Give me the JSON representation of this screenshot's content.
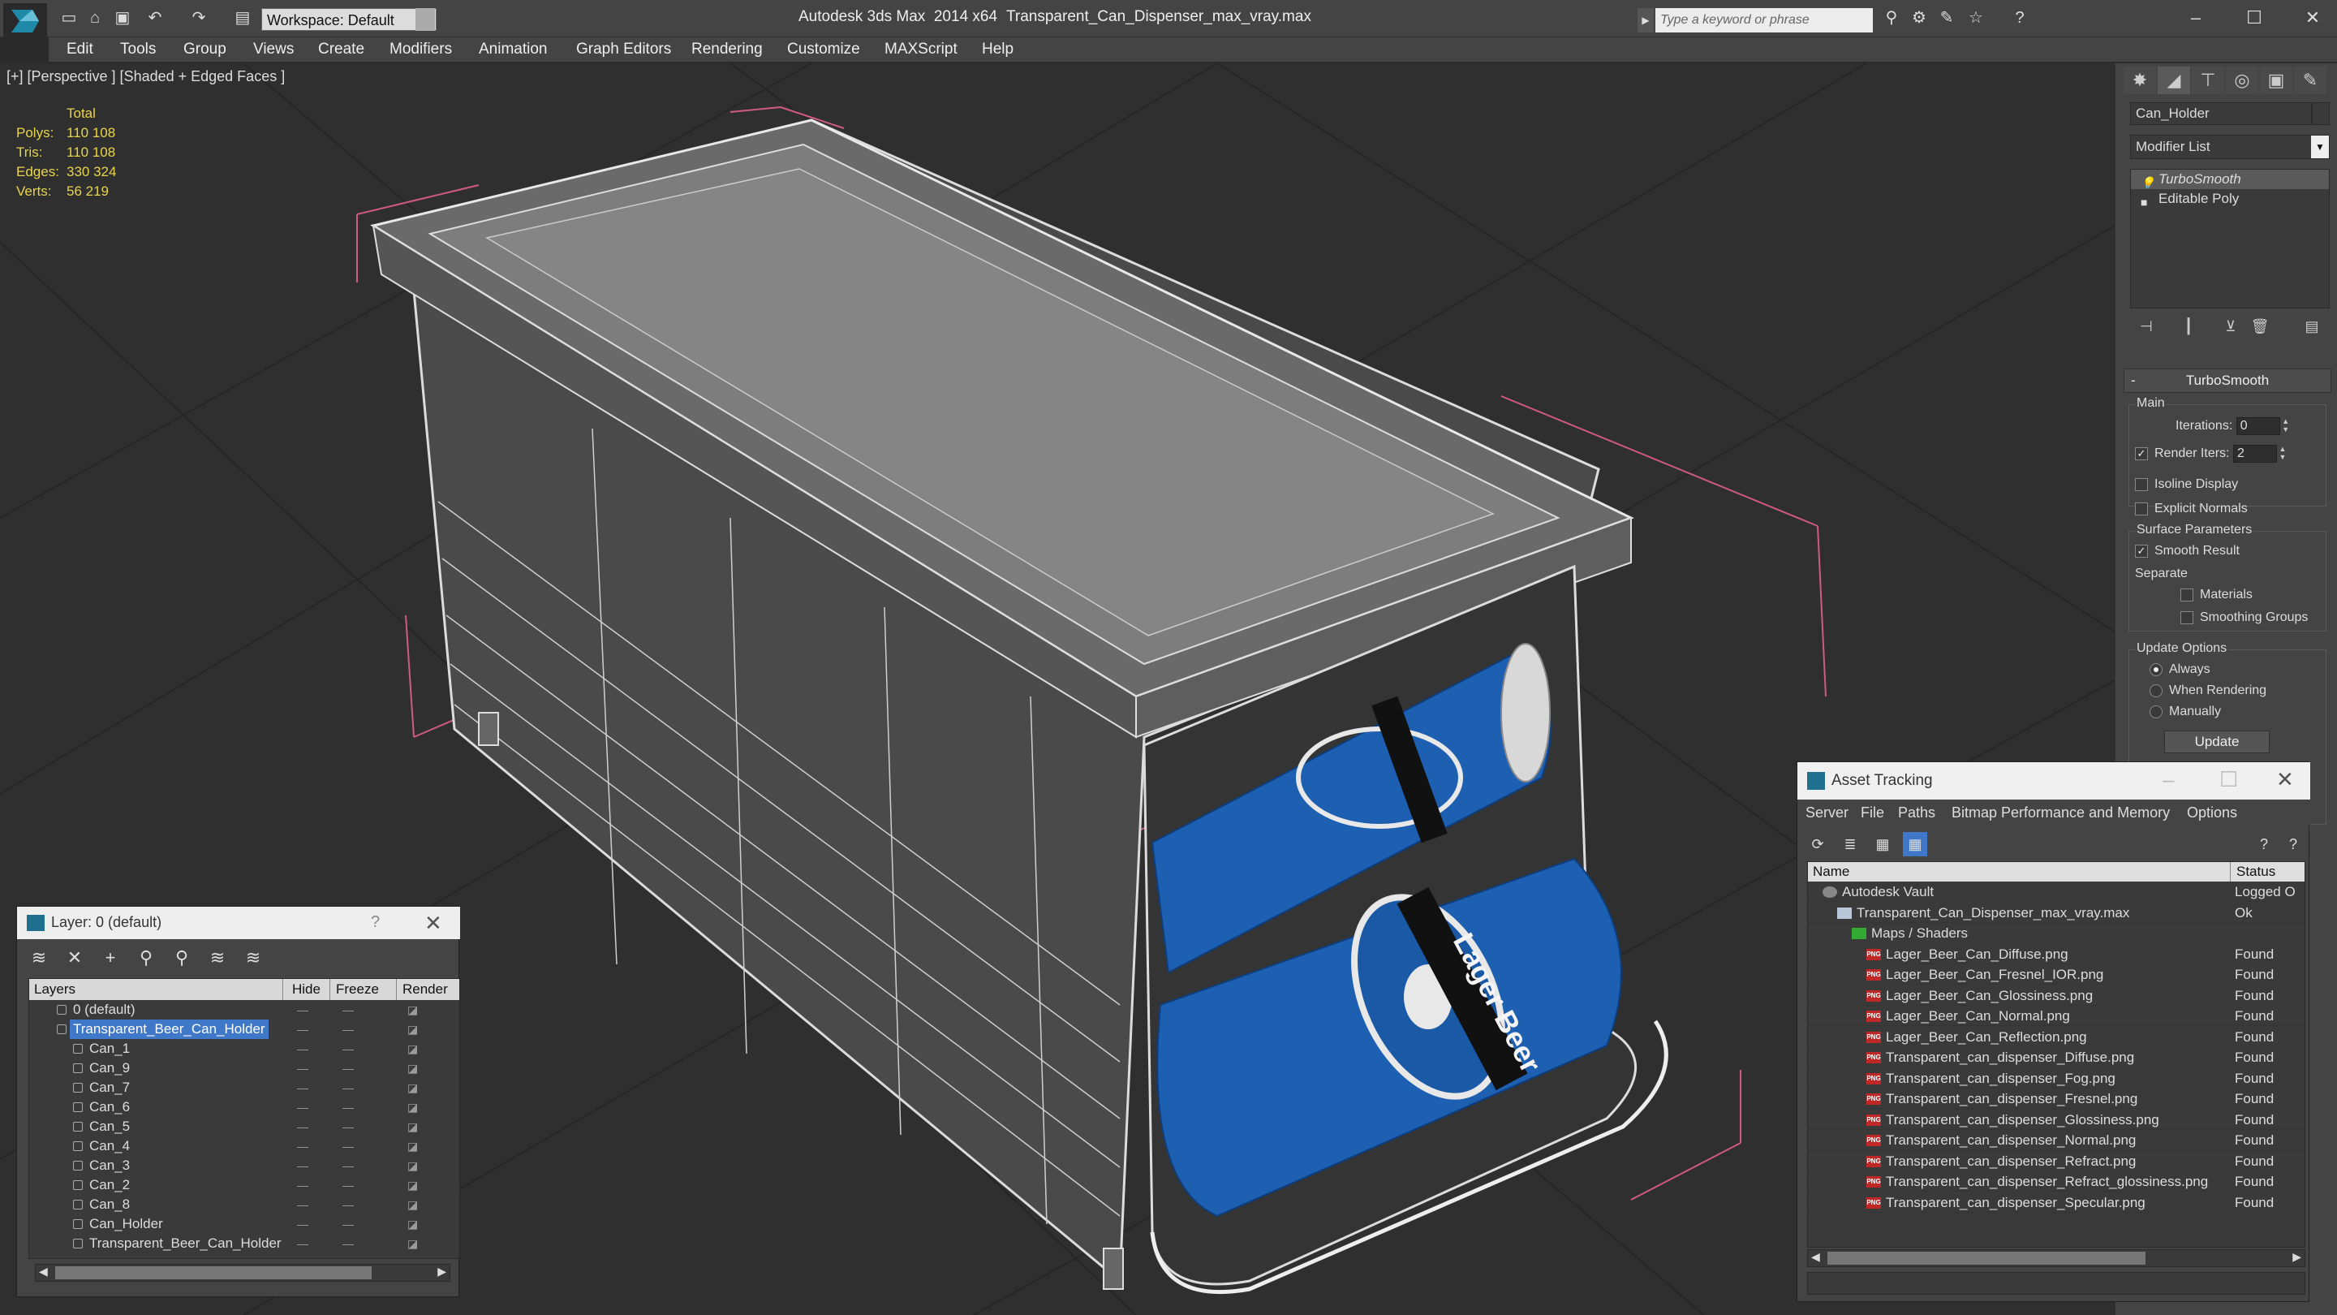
{
  "titlebar": {
    "workspace_label": "Workspace: Default",
    "app_title": "Autodesk 3ds Max  2014 x64",
    "file_title": "Transparent_Can_Dispenser_max_vray.max",
    "search_placeholder": "Type a keyword or phrase"
  },
  "menu": [
    "Edit",
    "Tools",
    "Group",
    "Views",
    "Create",
    "Modifiers",
    "Animation",
    "Graph Editors",
    "Rendering",
    "Customize",
    "MAXScript",
    "Help"
  ],
  "viewport": {
    "label": "[+] [Perspective ] [Shaded + Edged Faces ]",
    "stats": {
      "total_label": "Total",
      "polys_label": "Polys:",
      "polys": "110 108",
      "tris_label": "Tris:",
      "tris": "110 108",
      "edges_label": "Edges:",
      "edges": "330 324",
      "verts_label": "Verts:",
      "verts": "56 219"
    },
    "can_text": "Lager Beer"
  },
  "command_panel": {
    "object_name": "Can_Holder",
    "modifier_list": "Modifier List",
    "stack": [
      "TurboSmooth",
      "Editable Poly"
    ],
    "rollout_title": "TurboSmooth",
    "main_group": "Main",
    "iterations_label": "Iterations:",
    "iterations_value": "0",
    "render_iters_label": "Render Iters:",
    "render_iters_value": "2",
    "render_iters_checked": true,
    "isoline_label": "Isoline Display",
    "explicit_normals_label": "Explicit Normals",
    "surface_group": "Surface Parameters",
    "smooth_result_label": "Smooth Result",
    "smooth_result_checked": true,
    "separate_label": "Separate",
    "materials_label": "Materials",
    "smoothing_groups_label": "Smoothing Groups",
    "update_group": "Update Options",
    "always_label": "Always",
    "when_rendering_label": "When Rendering",
    "manually_label": "Manually",
    "selected_update": "Always",
    "update_button": "Update"
  },
  "layer_window": {
    "title": "Layer: 0 (default)",
    "help": "?",
    "columns": [
      "Layers",
      "Hide",
      "Freeze",
      "Render"
    ],
    "rows": [
      {
        "name": "0 (default)",
        "level": 1
      },
      {
        "name": "Transparent_Beer_Can_Holder",
        "level": 1,
        "selected": true
      },
      {
        "name": "Can_1",
        "level": 2
      },
      {
        "name": "Can_9",
        "level": 2
      },
      {
        "name": "Can_7",
        "level": 2
      },
      {
        "name": "Can_6",
        "level": 2
      },
      {
        "name": "Can_5",
        "level": 2
      },
      {
        "name": "Can_4",
        "level": 2
      },
      {
        "name": "Can_3",
        "level": 2
      },
      {
        "name": "Can_2",
        "level": 2
      },
      {
        "name": "Can_8",
        "level": 2
      },
      {
        "name": "Can_Holder",
        "level": 2
      },
      {
        "name": "Transparent_Beer_Can_Holder",
        "level": 2
      }
    ]
  },
  "asset_window": {
    "title": "Asset Tracking",
    "menu": [
      "Server",
      "File",
      "Paths",
      "Bitmap Performance and Memory",
      "Options"
    ],
    "col_name": "Name",
    "col_status": "Status",
    "rows": [
      {
        "name": "Autodesk Vault",
        "status": "Logged O",
        "level": 0,
        "kind": "vault"
      },
      {
        "name": "Transparent_Can_Dispenser_max_vray.max",
        "status": "Ok",
        "level": 1,
        "kind": "file"
      },
      {
        "name": "Maps / Shaders",
        "status": "",
        "level": 2,
        "kind": "folder"
      },
      {
        "name": "Lager_Beer_Can_Diffuse.png",
        "status": "Found",
        "level": 3,
        "kind": "png"
      },
      {
        "name": "Lager_Beer_Can_Fresnel_IOR.png",
        "status": "Found",
        "level": 3,
        "kind": "png"
      },
      {
        "name": "Lager_Beer_Can_Glossiness.png",
        "status": "Found",
        "level": 3,
        "kind": "png"
      },
      {
        "name": "Lager_Beer_Can_Normal.png",
        "status": "Found",
        "level": 3,
        "kind": "png"
      },
      {
        "name": "Lager_Beer_Can_Reflection.png",
        "status": "Found",
        "level": 3,
        "kind": "png"
      },
      {
        "name": "Transparent_can_dispenser_Diffuse.png",
        "status": "Found",
        "level": 3,
        "kind": "png"
      },
      {
        "name": "Transparent_can_dispenser_Fog.png",
        "status": "Found",
        "level": 3,
        "kind": "png"
      },
      {
        "name": "Transparent_can_dispenser_Fresnel.png",
        "status": "Found",
        "level": 3,
        "kind": "png"
      },
      {
        "name": "Transparent_can_dispenser_Glossiness.png",
        "status": "Found",
        "level": 3,
        "kind": "png"
      },
      {
        "name": "Transparent_can_dispenser_Normal.png",
        "status": "Found",
        "level": 3,
        "kind": "png"
      },
      {
        "name": "Transparent_can_dispenser_Refract.png",
        "status": "Found",
        "level": 3,
        "kind": "png"
      },
      {
        "name": "Transparent_can_dispenser_Refract_glossiness.png",
        "status": "Found",
        "level": 3,
        "kind": "png"
      },
      {
        "name": "Transparent_can_dispenser_Specular.png",
        "status": "Found",
        "level": 3,
        "kind": "png"
      }
    ]
  },
  "colors": {
    "stats_text": "#e8d44a",
    "selection": "#3f78c8",
    "can_blue": "#1d5fb0",
    "bbox_pink": "#d05a80"
  }
}
